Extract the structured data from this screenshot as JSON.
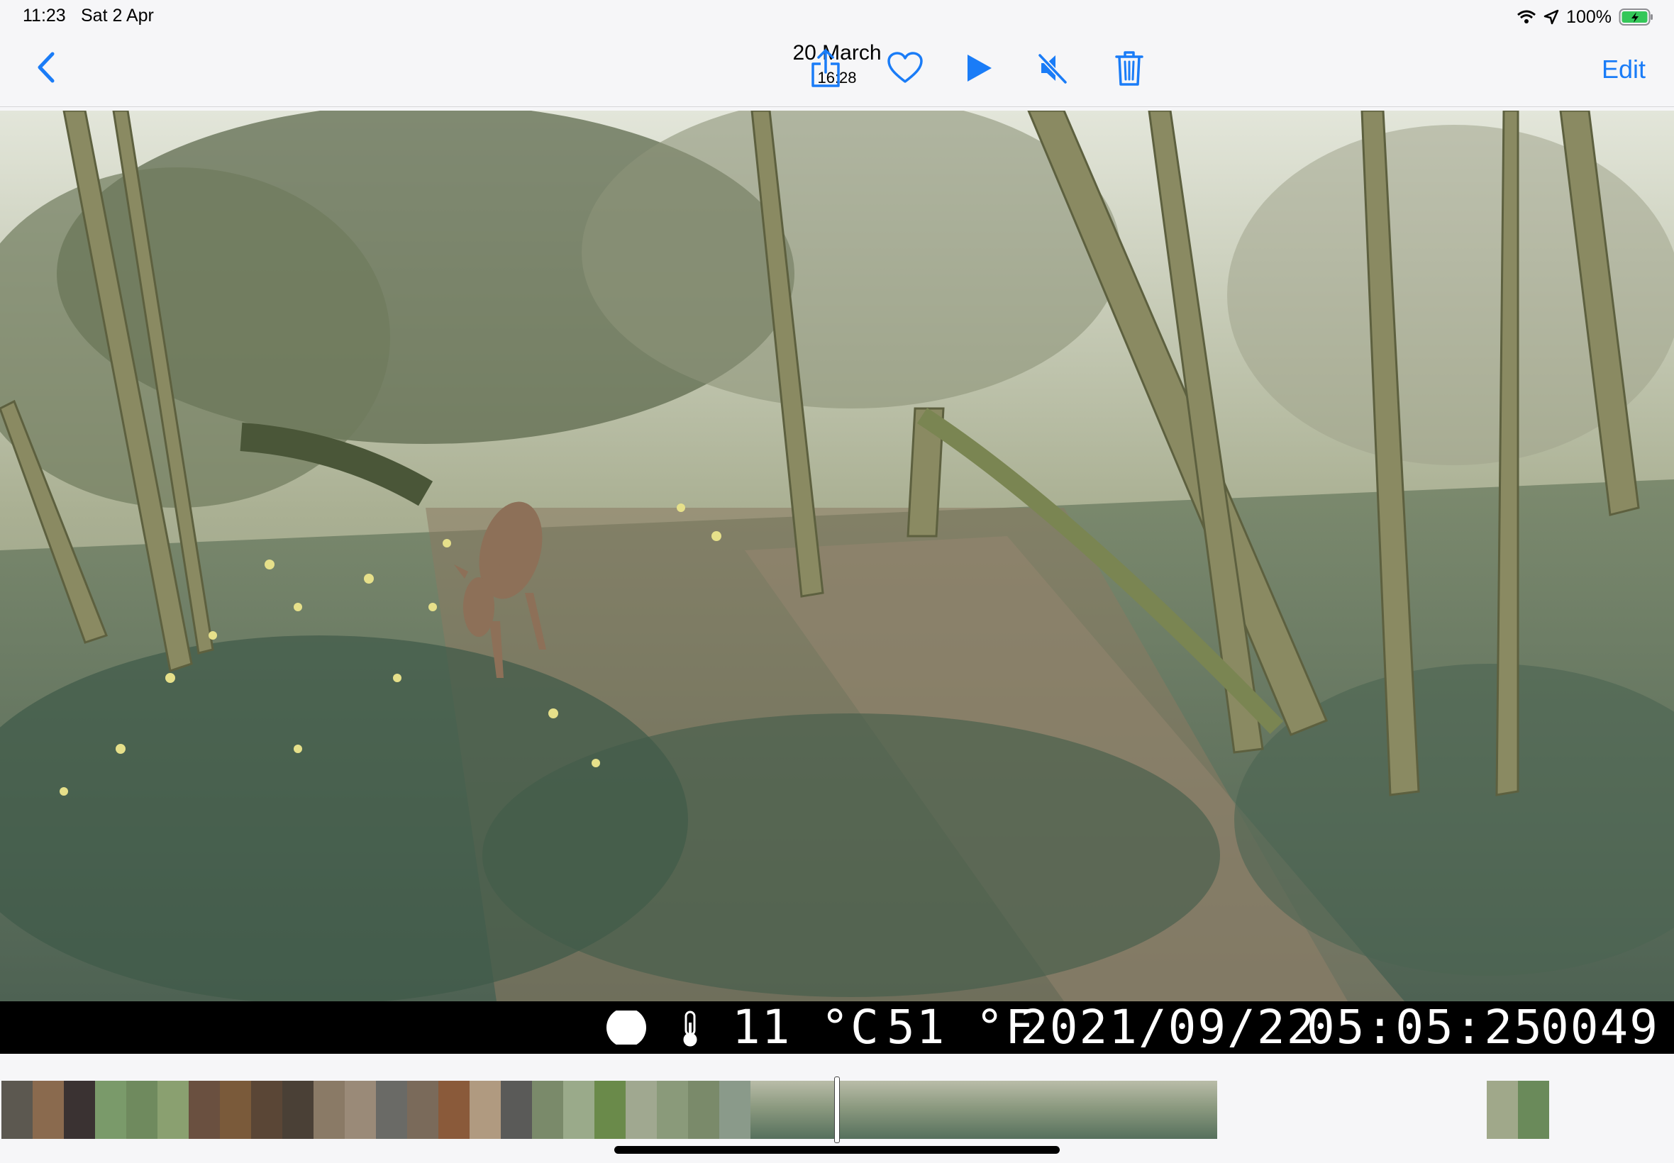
{
  "status_bar": {
    "time": "11:23",
    "date": "Sat 2 Apr",
    "battery": "100%",
    "icons": [
      "wifi-icon",
      "location-icon",
      "battery-charging-icon"
    ]
  },
  "nav": {
    "title_date": "20 March",
    "title_time": "16:28",
    "edit_label": "Edit",
    "accent_color": "#1a7cf7",
    "actions": [
      "share-icon",
      "heart-icon",
      "play-icon",
      "speaker-muted-icon",
      "trash-icon"
    ]
  },
  "photo": {
    "camera_overlay": {
      "temp_c": "11 °C",
      "temp_f": "51 °F",
      "timestamp": "2021/09/22",
      "clock": "05:05:25",
      "frame": "0049"
    }
  },
  "filmstrip": {
    "selected_index": 27
  }
}
